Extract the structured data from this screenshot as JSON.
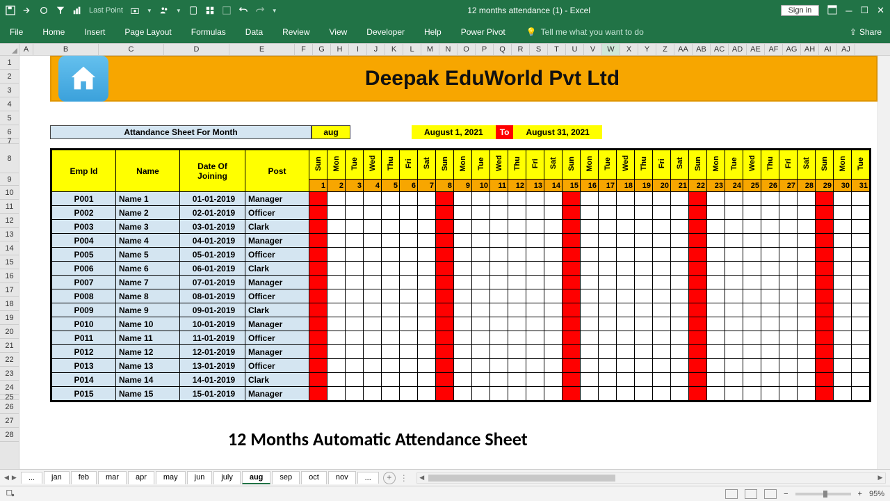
{
  "titleBar": {
    "title": "12 months attendance (1)  -  Excel",
    "signIn": "Sign in",
    "qat_lastpoint": "Last Point"
  },
  "ribbon": {
    "tabs": [
      "File",
      "Home",
      "Insert",
      "Page Layout",
      "Formulas",
      "Data",
      "Review",
      "View",
      "Developer",
      "Help",
      "Power Pivot"
    ],
    "tellme": "Tell me what you want to do",
    "share": "Share"
  },
  "columns": [
    "A",
    "B",
    "C",
    "D",
    "E",
    "F",
    "G",
    "H",
    "I",
    "J",
    "K",
    "L",
    "M",
    "N",
    "O",
    "P",
    "Q",
    "R",
    "S",
    "T",
    "U",
    "V",
    "W",
    "X",
    "Y",
    "Z",
    "AA",
    "AB",
    "AC",
    "AD",
    "AE",
    "AF",
    "AG",
    "AH",
    "AI",
    "AJ"
  ],
  "banner": {
    "title": "Deepak EduWorld Pvt Ltd"
  },
  "monthRow": {
    "label": "Attandance Sheet For Month",
    "value": "aug",
    "from": "August 1, 2021",
    "to": "To",
    "till": "August 31, 2021"
  },
  "headers": {
    "emp": "Emp Id",
    "name": "Name",
    "doj": "Date Of Joining",
    "post": "Post"
  },
  "days": [
    {
      "d": "Sun",
      "n": 1,
      "sun": true
    },
    {
      "d": "Mon",
      "n": 2
    },
    {
      "d": "Tue",
      "n": 3
    },
    {
      "d": "Wed",
      "n": 4
    },
    {
      "d": "Thu",
      "n": 5
    },
    {
      "d": "Fri",
      "n": 6
    },
    {
      "d": "Sat",
      "n": 7
    },
    {
      "d": "Sun",
      "n": 8,
      "sun": true
    },
    {
      "d": "Mon",
      "n": 9
    },
    {
      "d": "Tue",
      "n": 10
    },
    {
      "d": "Wed",
      "n": 11
    },
    {
      "d": "Thu",
      "n": 12
    },
    {
      "d": "Fri",
      "n": 13
    },
    {
      "d": "Sat",
      "n": 14
    },
    {
      "d": "Sun",
      "n": 15,
      "sun": true
    },
    {
      "d": "Mon",
      "n": 16
    },
    {
      "d": "Tue",
      "n": 17
    },
    {
      "d": "Wed",
      "n": 18
    },
    {
      "d": "Thu",
      "n": 19
    },
    {
      "d": "Fri",
      "n": 20
    },
    {
      "d": "Sat",
      "n": 21
    },
    {
      "d": "Sun",
      "n": 22,
      "sun": true
    },
    {
      "d": "Mon",
      "n": 23
    },
    {
      "d": "Tue",
      "n": 24
    },
    {
      "d": "Wed",
      "n": 25
    },
    {
      "d": "Thu",
      "n": 26
    },
    {
      "d": "Fri",
      "n": 27
    },
    {
      "d": "Sat",
      "n": 28
    },
    {
      "d": "Sun",
      "n": 29,
      "sun": true
    },
    {
      "d": "Mon",
      "n": 30
    },
    {
      "d": "Tue",
      "n": 31
    }
  ],
  "employees": [
    {
      "id": "P001",
      "name": "Name 1",
      "doj": "01-01-2019",
      "post": "Manager"
    },
    {
      "id": "P002",
      "name": "Name 2",
      "doj": "02-01-2019",
      "post": "Officer"
    },
    {
      "id": "P003",
      "name": "Name 3",
      "doj": "03-01-2019",
      "post": "Clark"
    },
    {
      "id": "P004",
      "name": "Name 4",
      "doj": "04-01-2019",
      "post": "Manager"
    },
    {
      "id": "P005",
      "name": "Name 5",
      "doj": "05-01-2019",
      "post": "Officer"
    },
    {
      "id": "P006",
      "name": "Name 6",
      "doj": "06-01-2019",
      "post": "Clark"
    },
    {
      "id": "P007",
      "name": "Name 7",
      "doj": "07-01-2019",
      "post": "Manager"
    },
    {
      "id": "P008",
      "name": "Name 8",
      "doj": "08-01-2019",
      "post": "Officer"
    },
    {
      "id": "P009",
      "name": "Name 9",
      "doj": "09-01-2019",
      "post": "Clark"
    },
    {
      "id": "P010",
      "name": "Name 10",
      "doj": "10-01-2019",
      "post": "Manager"
    },
    {
      "id": "P011",
      "name": "Name 11",
      "doj": "11-01-2019",
      "post": "Officer"
    },
    {
      "id": "P012",
      "name": "Name 12",
      "doj": "12-01-2019",
      "post": "Manager"
    },
    {
      "id": "P013",
      "name": "Name 13",
      "doj": "13-01-2019",
      "post": "Officer"
    },
    {
      "id": "P014",
      "name": "Name 14",
      "doj": "14-01-2019",
      "post": "Clark"
    },
    {
      "id": "P015",
      "name": "Name 15",
      "doj": "15-01-2019",
      "post": "Manager"
    }
  ],
  "caption": "12 Months Automatic Attendance Sheet",
  "sheetTabs": [
    "jan",
    "feb",
    "mar",
    "apr",
    "may",
    "jun",
    "july",
    "aug",
    "sep",
    "oct",
    "nov"
  ],
  "activeTab": "aug",
  "rowNums": [
    1,
    2,
    3,
    4,
    5,
    6,
    7,
    8,
    9,
    10,
    11,
    12,
    13,
    14,
    15,
    16,
    17,
    18,
    19,
    20,
    21,
    22,
    23,
    24,
    25,
    26,
    27,
    28
  ],
  "rowHeights": {
    "default": 20,
    "r7": 7,
    "r8": 42,
    "r9": 18,
    "r25": 8
  },
  "statusBar": {
    "zoom": "95%"
  },
  "selectedColumn": "W"
}
